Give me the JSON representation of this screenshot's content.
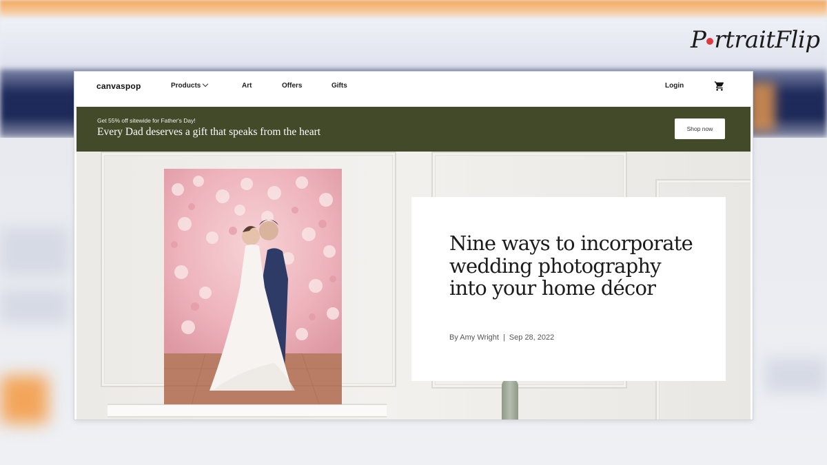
{
  "logo": {
    "text_part1": "P",
    "text_part2": "rtrait",
    "text_part3": "Flip"
  },
  "site": {
    "brand": "canvaspop",
    "nav": [
      {
        "label": "Products"
      },
      {
        "label": "Art"
      },
      {
        "label": "Offers"
      },
      {
        "label": "Gifts"
      }
    ],
    "login_label": "Login",
    "cart_icon": "cart-icon"
  },
  "promo": {
    "small_text": "Get 55% off sitewide for Father's Day!",
    "headline": "Every Dad deserves a gift that speaks from the heart",
    "button_label": "Shop now",
    "background_color": "#424a2a"
  },
  "article": {
    "title": "Nine ways to incorporate wedding photography into your home décor",
    "author": "By Amy Wright",
    "separator": "|",
    "date": "Sep 28, 2022"
  }
}
